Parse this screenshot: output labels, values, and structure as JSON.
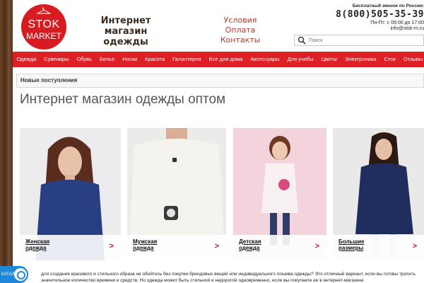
{
  "logo": {
    "line1": "STOK",
    "line2": "MARKET"
  },
  "header": {
    "site_title": "Интернет магазин одежды",
    "links": [
      "Условия",
      "Оплата",
      "Контакты"
    ],
    "contact": {
      "label": "Бесплатный звонок по России:",
      "phone": "8(800)505-35-39",
      "hours": "Пн-Пт: с 09:00 до 17:00",
      "email": "info@stok-m.ru"
    },
    "search_placeholder": "Поиск"
  },
  "nav": {
    "items": [
      "Одежда",
      "Сувениры",
      "Обувь",
      "Белье",
      "Носки",
      "Красота",
      "Галантерея",
      "Все для дома",
      "Аксессуары",
      "Для учебы",
      "Цветы",
      "Электроника",
      "Сток",
      "Отзывы"
    ]
  },
  "section_bar": "Новые поступления",
  "heading": "Интернет магазин одежды оптом",
  "cards": [
    {
      "label": "Женская одежда",
      "arrow": ">"
    },
    {
      "label": "Мужская одежда",
      "arrow": ">"
    },
    {
      "label": "Детская одежда",
      "arrow": ">"
    },
    {
      "label": "Большие размеры",
      "arrow": ">"
    }
  ],
  "footer_text": "для создания красивого и стильного образа не обойтись без покупки брендовых вещей или индивидуального пошива одежды? Это отличный вариант, если вы готовы тратить значительное количество времени и средств. Но одежда может быть стильной и недорогой одновременно, если вы покупаете ее в интернет-магазине",
  "catalog_label": "КАТАЛОГ",
  "colors": {
    "brand_red": "#dd2026",
    "logo_red": "#d81b21",
    "catalog_blue": "#1e88d6"
  }
}
